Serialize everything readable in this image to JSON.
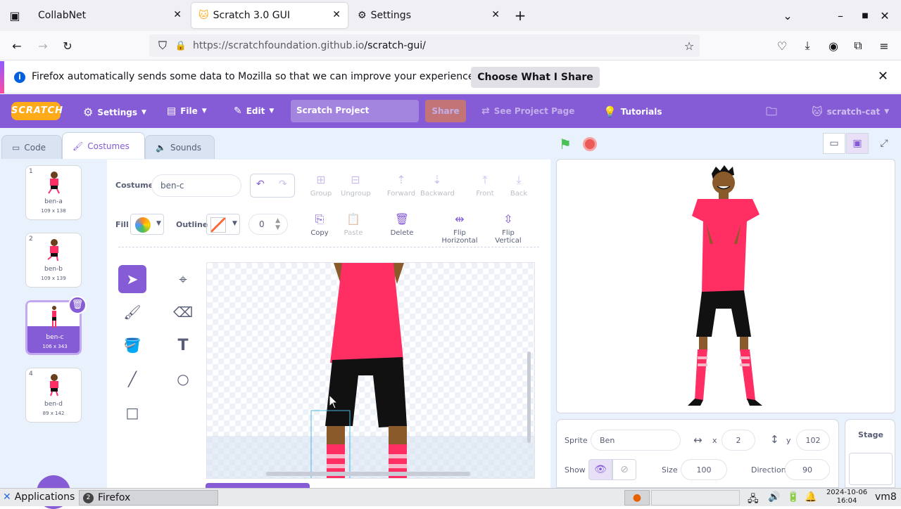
{
  "browser": {
    "tabs": [
      {
        "label": "CollabNet"
      },
      {
        "label": "Scratch 3.0 GUI"
      },
      {
        "label": "Settings"
      }
    ],
    "url_host": "https://scratchfoundation.github.io",
    "url_path": "/scratch-gui/",
    "notification": {
      "message": "Firefox automatically sends some data to Mozilla so that we can improve your experience.",
      "button": "Choose What I Share"
    }
  },
  "menubar": {
    "logo": "SCRATCH",
    "settings": "Settings",
    "file": "File",
    "edit": "Edit",
    "project_title": "Scratch Project",
    "share": "Share",
    "see_project_page": "See Project Page",
    "tutorials": "Tutorials",
    "username": "scratch-cat"
  },
  "editor_tabs": {
    "code": "Code",
    "costumes": "Costumes",
    "sounds": "Sounds"
  },
  "costumes": [
    {
      "num": "1",
      "name": "ben-a",
      "size": "109 x 138"
    },
    {
      "num": "2",
      "name": "ben-b",
      "size": "109 x 139"
    },
    {
      "num": "3",
      "name": "ben-c",
      "size": "106 x 343"
    },
    {
      "num": "4",
      "name": "ben-d",
      "size": "89 x 142"
    }
  ],
  "paint": {
    "costume_label": "Costume",
    "costume_name": "ben-c",
    "fill_label": "Fill",
    "outline_label": "Outline",
    "outline_width": "0",
    "buttons": {
      "group": "Group",
      "ungroup": "Ungroup",
      "forward": "Forward",
      "backward": "Backward",
      "front": "Front",
      "back": "Back",
      "copy": "Copy",
      "paste": "Paste",
      "delete": "Delete",
      "flip_h": "Flip Horizontal",
      "flip_v": "Flip Vertical"
    }
  },
  "sprite": {
    "sprite_label": "Sprite",
    "name": "Ben",
    "x_label": "x",
    "x": "2",
    "y_label": "y",
    "y": "102",
    "show_label": "Show",
    "size_label": "Size",
    "size": "100",
    "direction_label": "Direction",
    "direction": "90"
  },
  "stage_panel": {
    "label": "Stage"
  },
  "taskbar": {
    "applications": "Applications",
    "firefox": "Firefox",
    "firefox_count": "2",
    "date": "2024-10-06",
    "time": "16:04",
    "user": "vm8"
  },
  "colors": {
    "accent": "#855cd6",
    "shirt": "#ff2e63",
    "menubar": "#855cd6"
  }
}
